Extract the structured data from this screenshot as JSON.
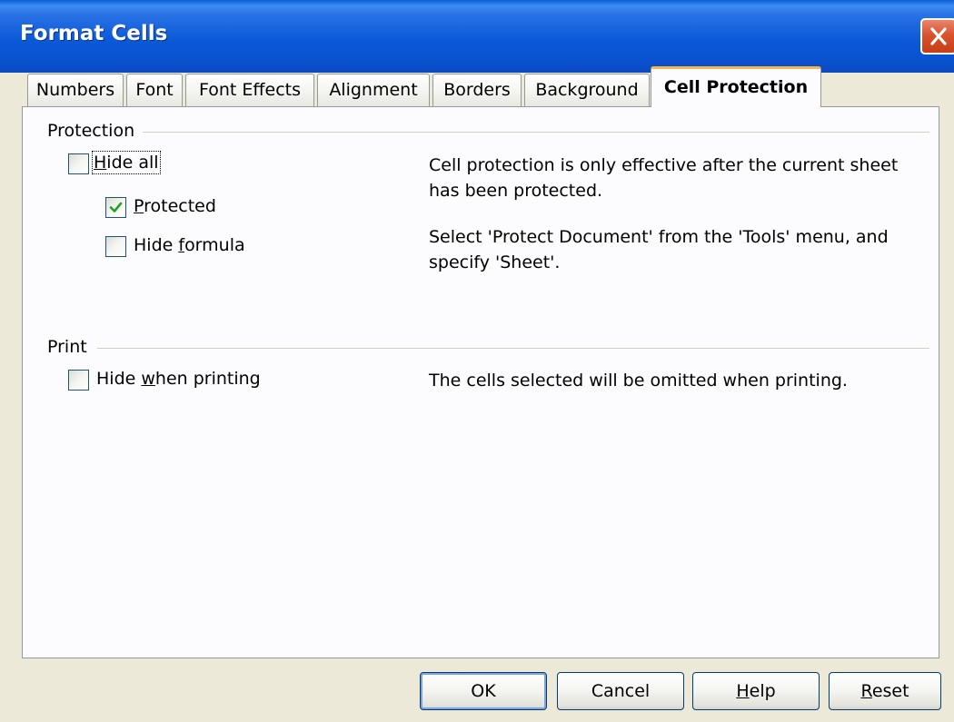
{
  "window": {
    "title": "Format Cells"
  },
  "tabs": [
    {
      "label": "Numbers",
      "active": false
    },
    {
      "label": "Font",
      "active": false
    },
    {
      "label": "Font Effects",
      "active": false
    },
    {
      "label": "Alignment",
      "active": false
    },
    {
      "label": "Borders",
      "active": false
    },
    {
      "label": "Background",
      "active": false
    },
    {
      "label": "Cell Protection",
      "active": true
    }
  ],
  "protection": {
    "section_label": "Protection",
    "hide_all": {
      "pre": "",
      "mnemonic": "H",
      "post": "ide all",
      "checked": false
    },
    "protected": {
      "pre": "",
      "mnemonic": "P",
      "post": "rotected",
      "checked": true
    },
    "hide_formula": {
      "pre": "Hide ",
      "mnemonic": "f",
      "post": "ormula",
      "checked": false
    },
    "description_1": "Cell protection is only effective after the current sheet has been protected.",
    "description_2": "Select 'Protect Document' from the 'Tools' menu, and specify 'Sheet'."
  },
  "print": {
    "section_label": "Print",
    "hide_when_printing": {
      "pre": "Hide ",
      "mnemonic": "w",
      "post": "hen printing",
      "checked": false
    },
    "description": "The cells selected will be omitted when printing."
  },
  "buttons": {
    "ok": {
      "pre": "",
      "mnemonic": "",
      "post": "OK"
    },
    "cancel": {
      "pre": "",
      "mnemonic": "",
      "post": "Cancel"
    },
    "help": {
      "pre": "",
      "mnemonic": "H",
      "post": "elp"
    },
    "reset": {
      "pre": "",
      "mnemonic": "R",
      "post": "eset"
    }
  },
  "colors": {
    "titlebar": "#0b5ad8",
    "close_button": "#d9532f",
    "active_tab_accent": "#f7b64f",
    "checkmark": "#21a121",
    "dialog_background": "#ece9d8"
  },
  "icons": {
    "close": "close-icon",
    "check": "checkmark-icon"
  }
}
